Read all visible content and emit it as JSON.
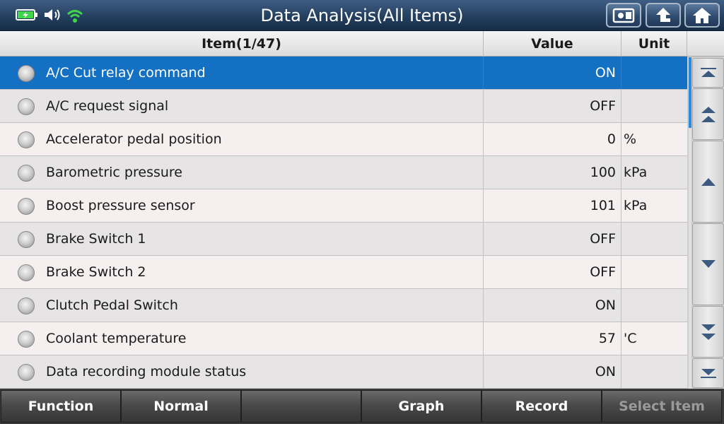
{
  "header": {
    "title": "Data Analysis(All Items)"
  },
  "status_icons": [
    "battery-charging-icon",
    "speaker-icon",
    "wifi-icon"
  ],
  "toolbar_icons": [
    "screenshot-icon",
    "back-arrow-icon",
    "home-icon"
  ],
  "table": {
    "columns": {
      "item": "Item(1/47)",
      "value": "Value",
      "unit": "Unit"
    },
    "rows": [
      {
        "label": "A/C Cut relay command",
        "value": "ON",
        "unit": "",
        "selected": true
      },
      {
        "label": "A/C request signal",
        "value": "OFF",
        "unit": ""
      },
      {
        "label": "Accelerator pedal position",
        "value": "0",
        "unit": "%"
      },
      {
        "label": "Barometric pressure",
        "value": "100",
        "unit": "kPa"
      },
      {
        "label": "Boost pressure sensor",
        "value": "101",
        "unit": "kPa"
      },
      {
        "label": "Brake Switch 1",
        "value": "OFF",
        "unit": ""
      },
      {
        "label": "Brake Switch 2",
        "value": "OFF",
        "unit": ""
      },
      {
        "label": "Clutch Pedal Switch",
        "value": "ON",
        "unit": ""
      },
      {
        "label": "Coolant temperature",
        "value": "57",
        "unit": "'C"
      },
      {
        "label": "Data recording module status",
        "value": "ON",
        "unit": ""
      }
    ]
  },
  "scroll_icons": [
    "scroll-top-icon",
    "page-up-icon",
    "scroll-up-icon",
    "scroll-down-icon",
    "page-down-icon",
    "scroll-bottom-icon"
  ],
  "bottom_bar": {
    "function": "Function",
    "normal": "Normal",
    "empty": "",
    "graph": "Graph",
    "record": "Record",
    "select_item": "Select Item"
  },
  "colors": {
    "selected_row": "#1470c2",
    "wifi": "#3fd44a",
    "battery": "#3fd44a",
    "scroll_thumb": "#2a8ae0"
  }
}
